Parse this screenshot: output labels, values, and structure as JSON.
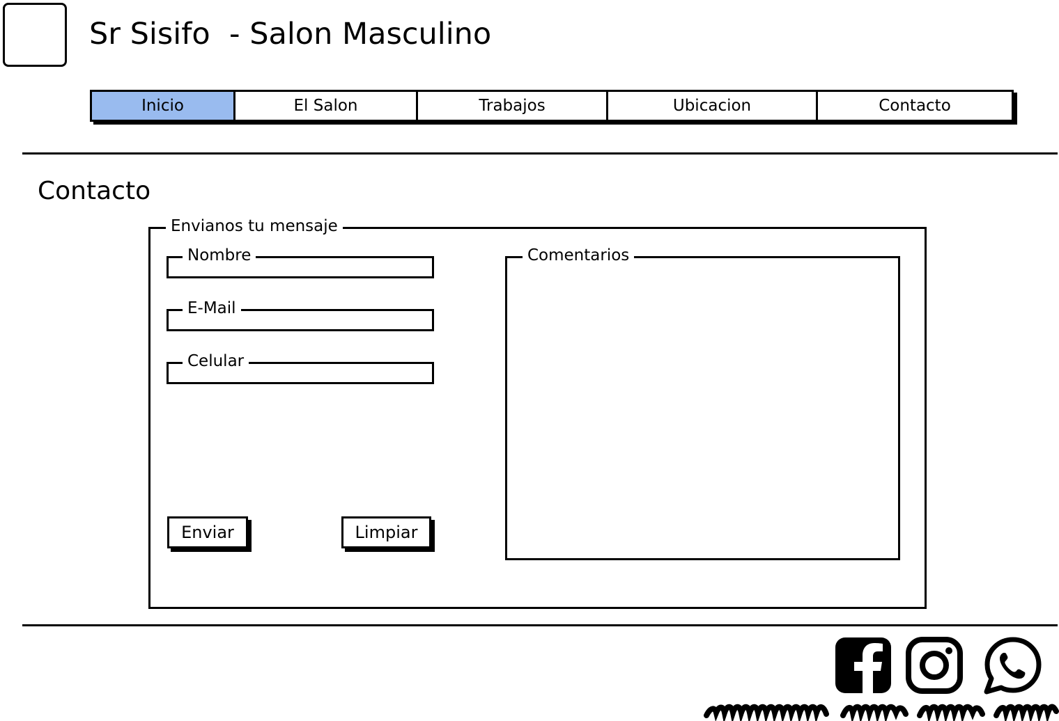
{
  "header": {
    "title": "Sr Sisifo  - Salon Masculino"
  },
  "nav": {
    "tabs": [
      {
        "label": "Inicio",
        "active": true
      },
      {
        "label": "El Salon",
        "active": false
      },
      {
        "label": "Trabajos",
        "active": false
      },
      {
        "label": "Ubicacion",
        "active": false
      },
      {
        "label": "Contacto",
        "active": false
      }
    ],
    "active_color": "#99bbef"
  },
  "contact": {
    "title": "Contacto",
    "form": {
      "legend": "Envianos tu mensaje",
      "fields": [
        {
          "label": "Nombre",
          "value": ""
        },
        {
          "label": "E-Mail",
          "value": ""
        },
        {
          "label": "Celular",
          "value": ""
        }
      ],
      "comments": {
        "label": "Comentarios",
        "value": ""
      },
      "send_label": "Enviar",
      "clear_label": "Limpiar"
    }
  },
  "footer": {
    "social_icons": [
      "facebook-icon",
      "instagram-icon",
      "whatsapp-icon"
    ]
  }
}
